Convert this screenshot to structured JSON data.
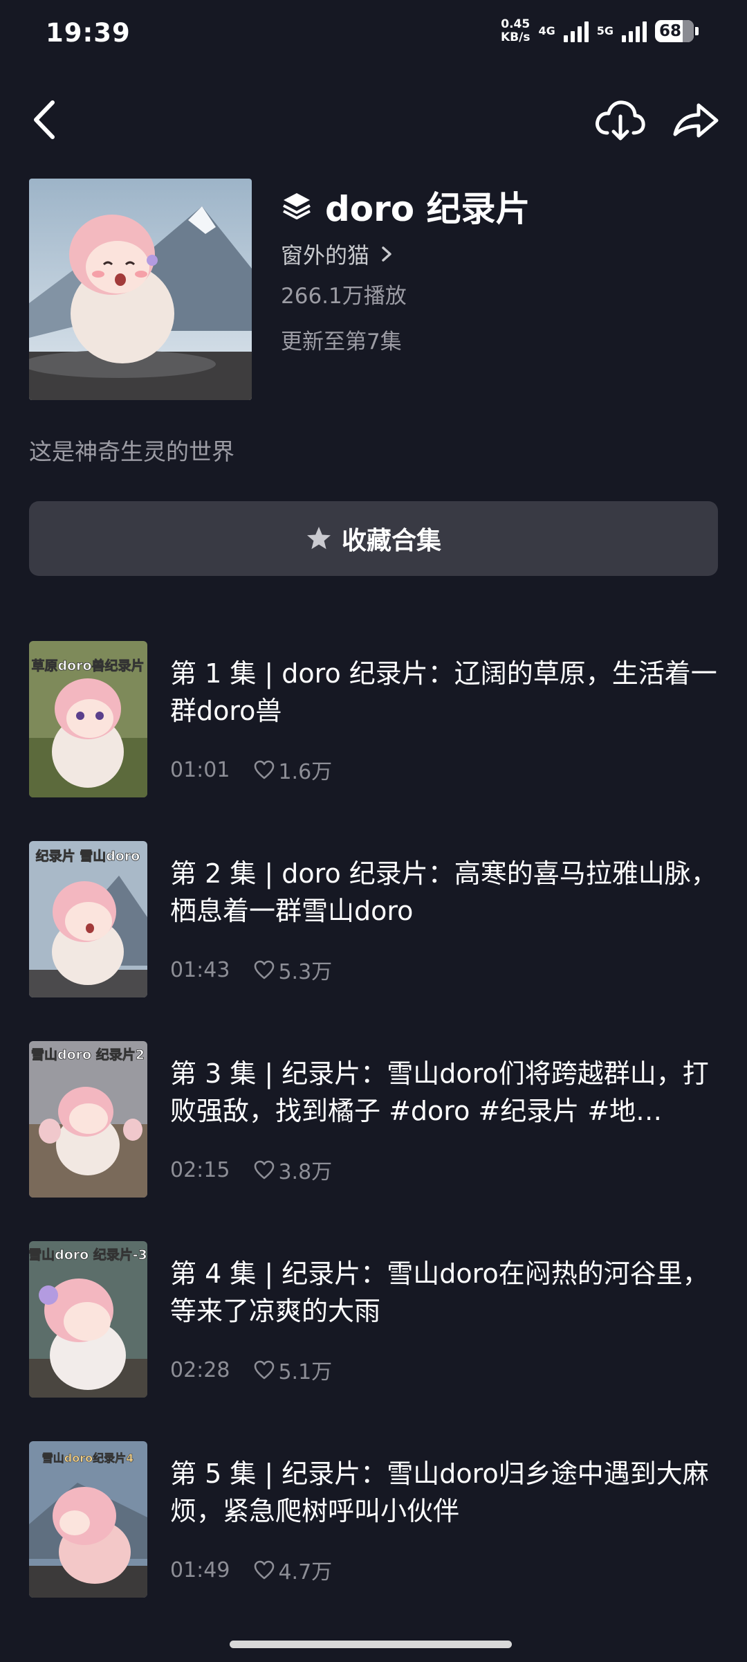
{
  "status_bar": {
    "time": "19:39",
    "net_speed": "0.45",
    "net_speed_unit": "KB/s",
    "net_type_1": "4G",
    "net_type_2": "5G",
    "battery": "68"
  },
  "nav": {
    "back_icon": "chevron-left-icon",
    "download_icon": "cloud-download-icon",
    "share_icon": "share-arrow-icon"
  },
  "collection": {
    "title": "doro 纪录片",
    "author": "窗外的猫",
    "plays": "266.1万播放",
    "update": "更新至第7集",
    "description": "这是神奇生灵的世界",
    "favorite_label": "收藏合集"
  },
  "episodes": [
    {
      "title": "第 1 集 | doro 纪录片：辽阔的草原，生活着一群doro兽",
      "duration": "01:01",
      "likes": "1.6万",
      "thumb_caption": "草原doro兽纪录片"
    },
    {
      "title": "第 2 集 | doro 纪录片：高寒的喜马拉雅山脉，栖息着一群雪山doro",
      "duration": "01:43",
      "likes": "5.3万",
      "thumb_caption": "纪录片 雪山doro"
    },
    {
      "title": "第 3 集 | 纪录片：雪山doro们将跨越群山，打败强敌，找到橘子 #doro #纪录片 #地…",
      "duration": "02:15",
      "likes": "3.8万",
      "thumb_caption": "雪山doro 纪录片2"
    },
    {
      "title": "第 4 集 | 纪录片：雪山doro在闷热的河谷里，等来了凉爽的大雨",
      "duration": "02:28",
      "likes": "5.1万",
      "thumb_caption": "雪山doro 纪录片-3"
    },
    {
      "title": "第 5 集 | 纪录片：雪山doro归乡途中遇到大麻烦，紧急爬树呼叫小伙伴",
      "duration": "01:49",
      "likes": "4.7万",
      "thumb_caption": "雪山doro纪录片4"
    }
  ],
  "colors": {
    "background": "#161823",
    "button": "#393a44",
    "muted_text": "#9c9ca4"
  }
}
